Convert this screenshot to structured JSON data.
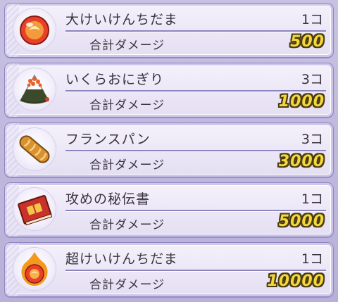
{
  "damage_label": "合計ダメージ",
  "items": [
    {
      "name": "大けいけんちだま",
      "count": "1コ",
      "damage": "500",
      "icon": "red-orb-icon"
    },
    {
      "name": "いくらおにぎり",
      "count": "3コ",
      "damage": "1000",
      "icon": "onigiri-icon"
    },
    {
      "name": "フランスパン",
      "count": "3コ",
      "damage": "3000",
      "icon": "baguette-icon"
    },
    {
      "name": "攻めの秘伝書",
      "count": "1コ",
      "damage": "5000",
      "icon": "scroll-book-icon"
    },
    {
      "name": "超けいけんちだま",
      "count": "1コ",
      "damage": "10000",
      "icon": "flame-orb-icon"
    }
  ],
  "colors": {
    "panel_bg": "#efebf8",
    "border": "#8f86c0",
    "damage_gold": "#f3d73b",
    "text": "#3a3440"
  }
}
